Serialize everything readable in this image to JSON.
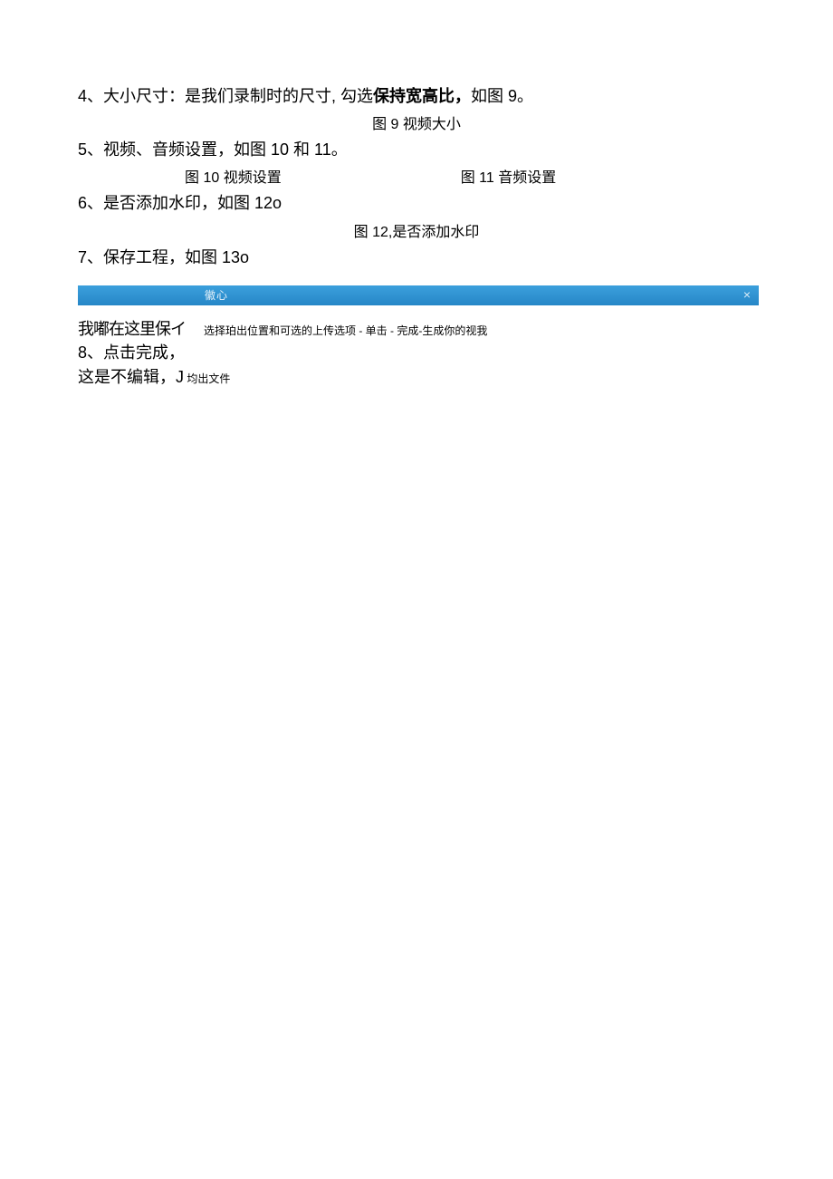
{
  "items": {
    "p4_prefix": "4、大小尺寸：是我们录制时的尺寸, 勾选",
    "p4_bold": "保持宽高比，",
    "p4_suffix": "如图 9。",
    "cap9": "图 9 视频大小",
    "p5": "5、视频、音频设置，如图 10 和 11。",
    "cap10": "图 10 视频设置",
    "cap11": "图 11 音频设置",
    "p6": "6、是否添加水印，如图 12o",
    "cap12": "图 12,是否添加水印",
    "p7": "7、保存工程，如图 13o"
  },
  "bar": {
    "text": "徽心",
    "close": "×"
  },
  "afterBar": {
    "leftText": "我嘟在这里保イ",
    "subText": "选择珀出位置和可选的上传选项 - 单击 - 完成-生成你的视我"
  },
  "tail": {
    "p8": "8、点击完成，",
    "p9_prefix": "这是不编辑，J",
    "p9_small": " 均出文件"
  }
}
